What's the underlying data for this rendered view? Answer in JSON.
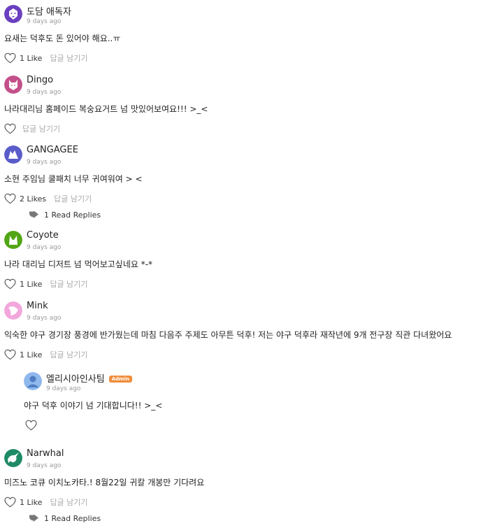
{
  "comments": [
    {
      "name": "도담 애독자",
      "time": "9 days ago",
      "text": "요새는 덕후도 돈 있어야 해요..ㅠ",
      "likes": "1 Like",
      "reply": "답글 남기기",
      "avatar_color": "#6a3fc0"
    },
    {
      "name": "Dingo",
      "time": "9 days ago",
      "text": "나라대리님 홈페이드 복숭요거트 넘 맛있어보여요!!! >_<",
      "likes": "",
      "reply": "답글 남기기",
      "avatar_color": "#c3508a"
    },
    {
      "name": "GANGAGEE",
      "time": "9 days ago",
      "text": "소현 주임님 쿨패치 너무 귀여워여 > <",
      "likes": "2 Likes",
      "reply": "답글 남기기",
      "avatar_color": "#5a5cc9",
      "read_replies": "1 Read Replies"
    },
    {
      "name": "Coyote",
      "time": "9 days ago",
      "text": "나라 대리님 디저트 넘 먹어보고싶네요 *-*",
      "likes": "1 Like",
      "reply": "답글 남기기",
      "avatar_color": "#52a615"
    },
    {
      "name": "Mink",
      "time": "9 days ago",
      "text": "익숙한 야구 경기장 풍경에 반가웠는데 마침 다음주 주제도 아무튼 덕후! 저는 야구 덕후라 재작년에 9개 전구장 직관 다녀왔어요",
      "likes": "1 Like",
      "reply": "답글 남기기",
      "avatar_color": "#f2a7dc"
    },
    {
      "name": "Narwhal",
      "time": "9 days ago",
      "text": "미즈노 코큐 이치노카타.! 8월22일 귀칼 개봉만 기다려요",
      "likes": "1 Like",
      "reply": "답글 남기기",
      "avatar_color": "#1f8a66",
      "read_replies": "1 Read Replies"
    }
  ],
  "admin_reply": {
    "name": "엘리시아인사팀",
    "badge": "Admin",
    "time": "9 days ago",
    "text": "야구 덕후 이야기 넘 기대합니다!! >_<",
    "avatar_color": "#8fb8ec"
  },
  "icons": {
    "like": "heart-outline-icon",
    "replies": "reply-arrow-icon"
  }
}
